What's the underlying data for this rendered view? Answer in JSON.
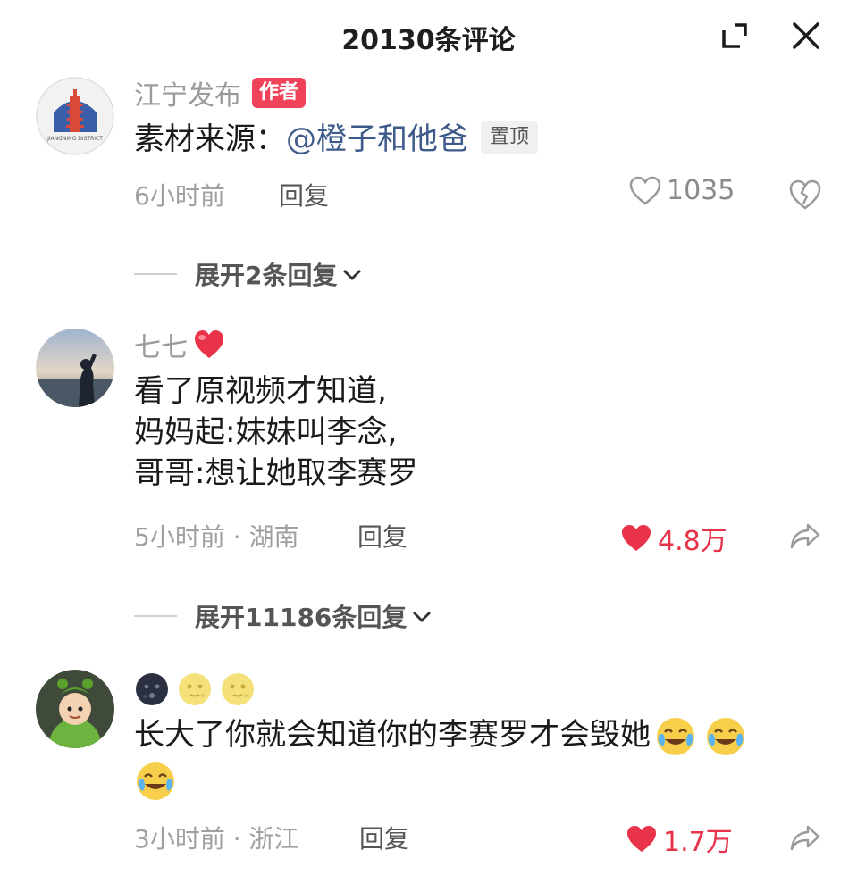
{
  "header": {
    "title": "20130条评论",
    "collapse_icon": "collapse-icon",
    "close_icon": "close-icon"
  },
  "comments": [
    {
      "name": "江宁发布",
      "author_badge": "作者",
      "avatar_text": "JIANGNING DISTRICT",
      "text_prefix": "素材来源：",
      "mention": "@橙子和他爸",
      "pin_badge": "置顶",
      "time": "6小时前",
      "reply": "回复",
      "likes": "1035",
      "liked": false,
      "right_icon": "dislike-heart-icon",
      "expand": "展开2条回复"
    },
    {
      "name": "七七",
      "name_emoji": "red-heart-emoji",
      "lines": [
        "看了原视频才知道,",
        "妈妈起:妹妹叫李念,",
        "哥哥:想让她取李赛罗"
      ],
      "time": "5小时前 · 湖南",
      "reply": "回复",
      "likes": "4.8万",
      "liked": true,
      "right_icon": "share-arrow-icon",
      "expand": "展开11186条回复"
    },
    {
      "name_emojis": [
        "new-moon-face-emoji",
        "full-moon-face-emoji",
        "full-moon-face-emoji"
      ],
      "text": "长大了你就会知道你的李赛罗才会毁她",
      "text_emojis": [
        "crying-laughing-emoji",
        "crying-laughing-emoji",
        "crying-laughing-emoji"
      ],
      "time": "3小时前 · 浙江",
      "reply": "回复",
      "likes": "1.7万",
      "liked": true,
      "right_icon": "share-arrow-icon"
    }
  ],
  "colors": {
    "author_badge": "#f0435a",
    "like_red": "#e8334a",
    "mention": "#3d5a8a"
  }
}
